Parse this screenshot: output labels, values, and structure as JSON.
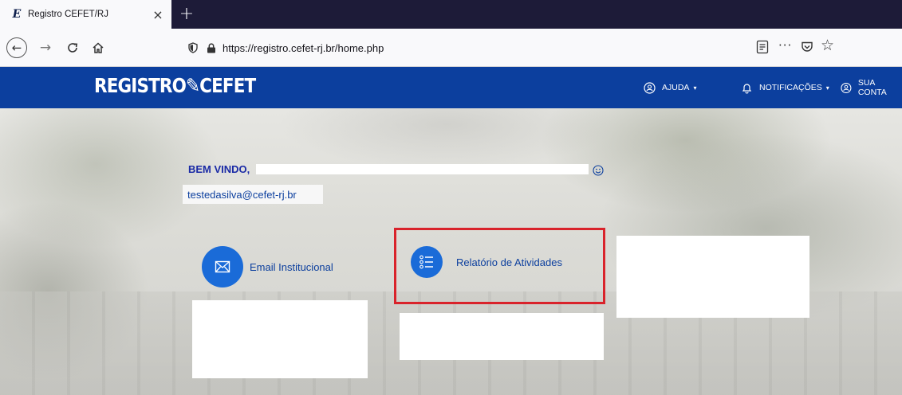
{
  "browser": {
    "tab": {
      "title": "Registro CEFET/RJ",
      "favicon": "cefet-logo-icon",
      "close": "×"
    },
    "new_tab": "+",
    "url": "https://registro.cefet-rj.br/home.php",
    "icons": {
      "back": "←",
      "forward": "→",
      "reload": "C",
      "home": "⌂",
      "more": "···",
      "bookmark": "☆"
    }
  },
  "header": {
    "logo": "REGISTRO✎CEFET",
    "nav": {
      "help": "AJUDA",
      "notifications": "NOTIFICAÇÕES",
      "account": "SUA CONTA",
      "caret": "▾"
    },
    "color": "#0c3f9e"
  },
  "main": {
    "welcome": "BEM VINDO,",
    "email": "testedasilva@cefet-rj.br",
    "shortcuts": [
      {
        "label": "Email Institucional",
        "icon": "envelope-icon"
      },
      {
        "label": "Relatório de Atividades",
        "icon": "list-icon"
      }
    ],
    "accent": "#1a6bd8",
    "highlight_color": "#d9232b"
  }
}
